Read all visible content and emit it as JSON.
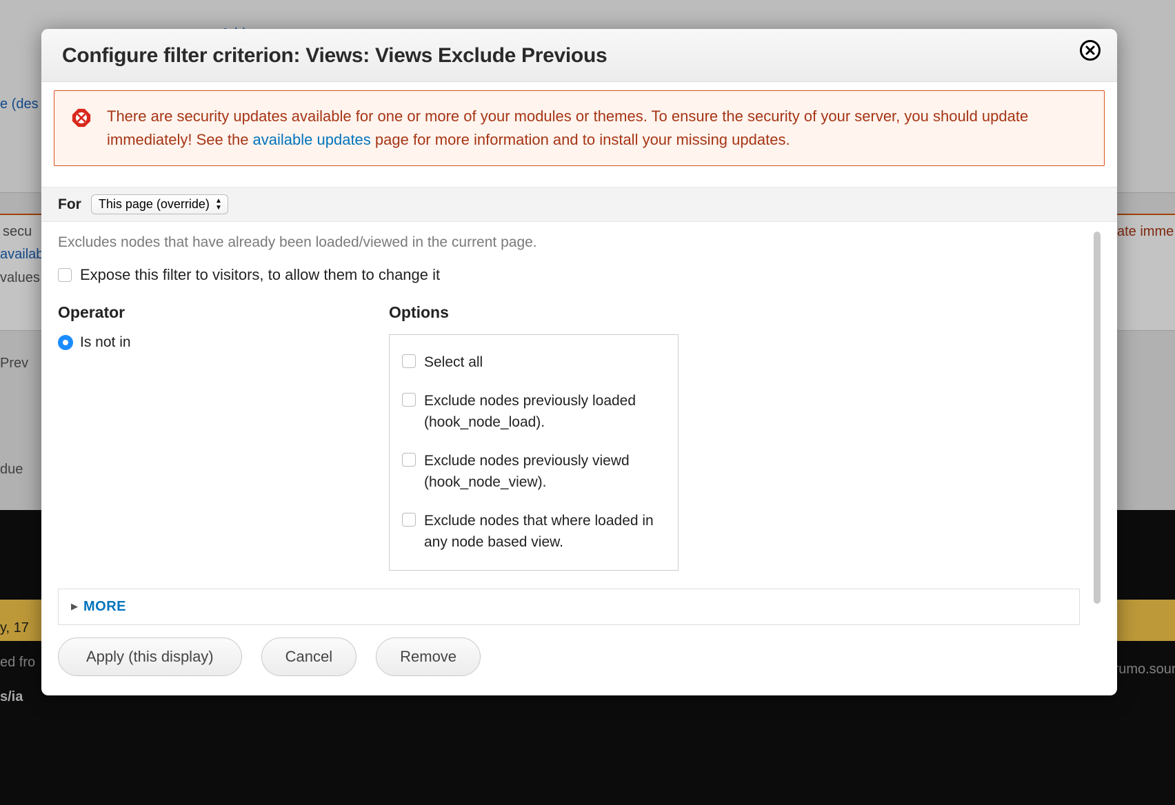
{
  "modal": {
    "title": "Configure filter criterion: Views: Views Exclude Previous"
  },
  "alert": {
    "text_before_link": "There are security updates available for one or more of your modules or themes. To ensure the security of your server, you should update immediately! See the ",
    "link_text": "available updates",
    "text_after_link": " page for more information and to install your missing updates."
  },
  "for_bar": {
    "label": "For",
    "selected": "This page (override)"
  },
  "description": "Excludes nodes that have already been loaded/viewed in the current page.",
  "expose_label": "Expose this filter to visitors, to allow them to change it",
  "operator": {
    "heading": "Operator",
    "value_label": "Is not in"
  },
  "options": {
    "heading": "Options",
    "items": [
      "Select all",
      "Exclude nodes previously loaded (hook_node_load).",
      "Exclude nodes previously viewd (hook_node_view).",
      "Exclude nodes that where loaded in any node based view."
    ]
  },
  "more_label": "MORE",
  "buttons": {
    "apply": "Apply (this display)",
    "cancel": "Cancel",
    "remove": "Remove"
  },
  "bg_fragments": {
    "add": "Add",
    "desc": "e (des",
    "secu": "secu",
    "availab": "availab",
    "values": "values",
    "prev": "Prev",
    "due": "due",
    "date_imme": "ate imme",
    "krumo": "/krumo.sour",
    "ed_fro": "ed fro",
    "s_ia": "s/ia",
    "y17": "y, 17"
  }
}
